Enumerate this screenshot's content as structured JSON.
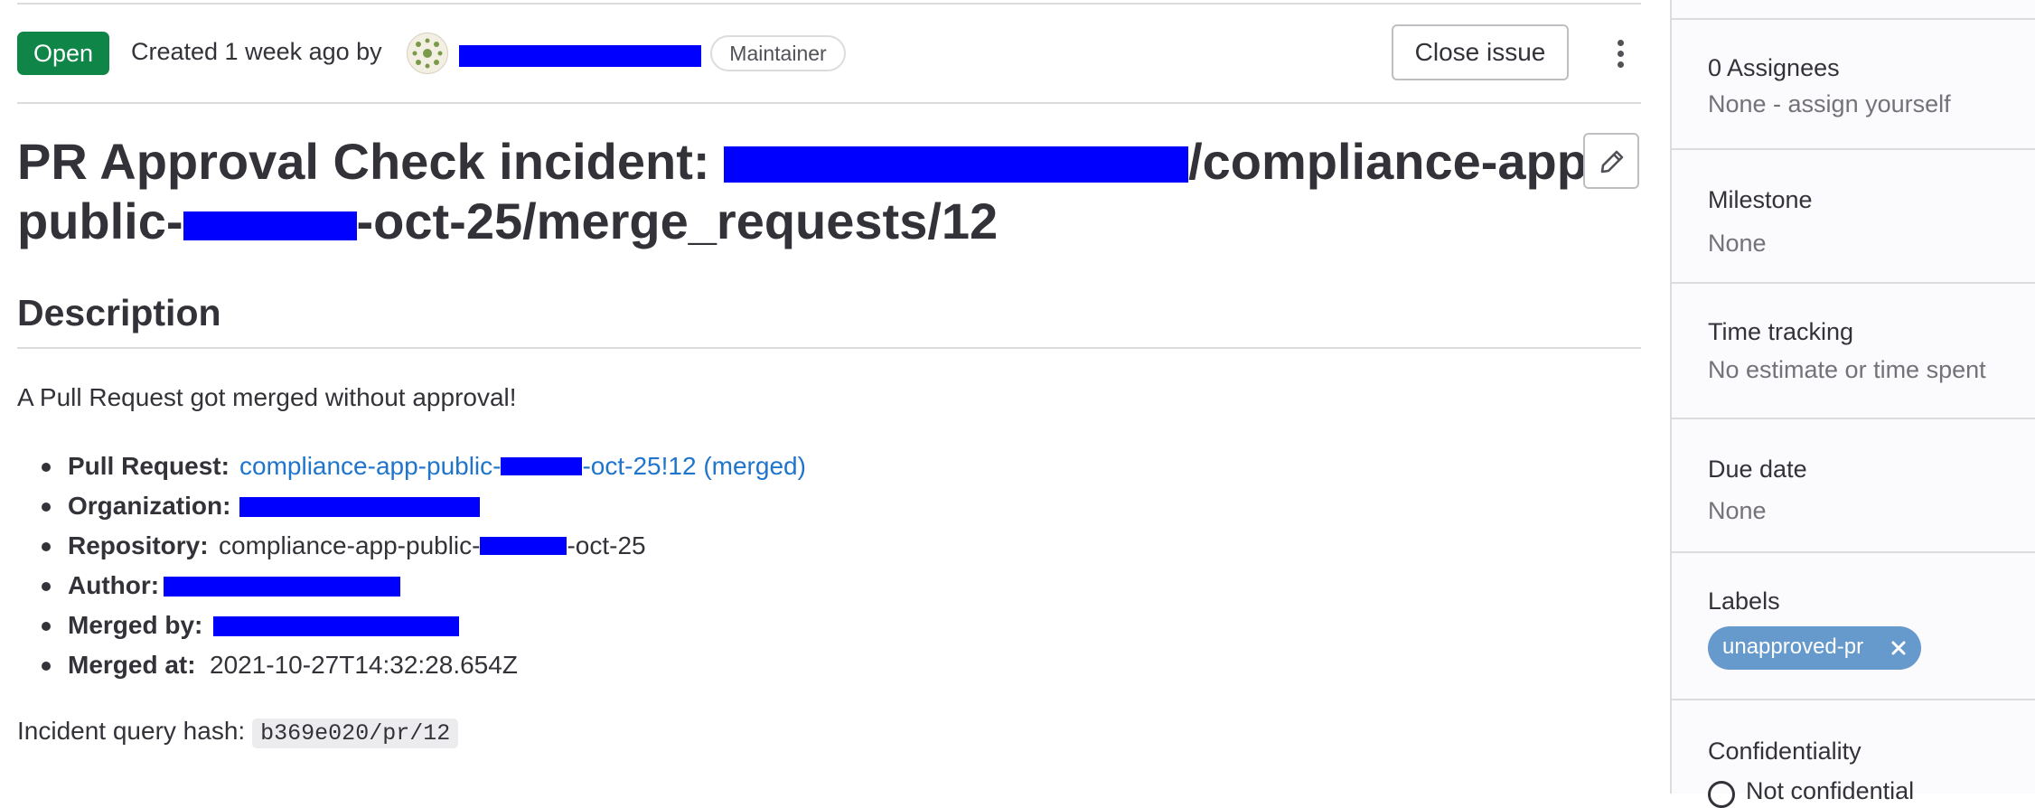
{
  "issue": {
    "status": "Open",
    "created_text": "Created 1 week ago by",
    "role_badge": "Maintainer",
    "close_label": "Close issue",
    "title_line1_prefix": "PR Approval Check incident: ",
    "title_line1_suffix": "/compliance-app-",
    "title_line2_prefix": "public-",
    "title_line2_suffix": "-oct-25/merge_requests/12"
  },
  "description": {
    "heading": "Description",
    "intro": "A Pull Request got merged without approval!",
    "items": [
      {
        "label": "Pull Request:",
        "value_prefix": "compliance-app-public-",
        "value_suffix": "-oct-25!12 (merged)"
      },
      {
        "label": "Organization:"
      },
      {
        "label": "Repository:",
        "value_prefix": "compliance-app-public-",
        "value_suffix": "-oct-25"
      },
      {
        "label": "Author:"
      },
      {
        "label": "Merged by:"
      },
      {
        "label": "Merged at:",
        "value": "2021-10-27T14:32:28.654Z"
      }
    ],
    "hash_label": "Incident query hash:",
    "hash_value": "b369e020/pr/12"
  },
  "sidebar": {
    "assignees_title": "0 Assignees",
    "assignees_value": "None - assign yourself",
    "milestone_title": "Milestone",
    "milestone_value": "None",
    "time_title": "Time tracking",
    "time_value": "No estimate or time spent",
    "due_title": "Due date",
    "due_value": "None",
    "labels_title": "Labels",
    "label_pill": "unapproved-pr",
    "label_color": "#6699cc",
    "confidentiality_title": "Confidentiality",
    "confidentiality_value": "Not confidential"
  },
  "colors": {
    "open_badge": "#108548",
    "link": "#1f75cb",
    "redaction": "#0000ff"
  },
  "icons": [
    "kebab-menu-icon",
    "pencil-icon",
    "close-x-icon",
    "eye-slash-icon"
  ]
}
